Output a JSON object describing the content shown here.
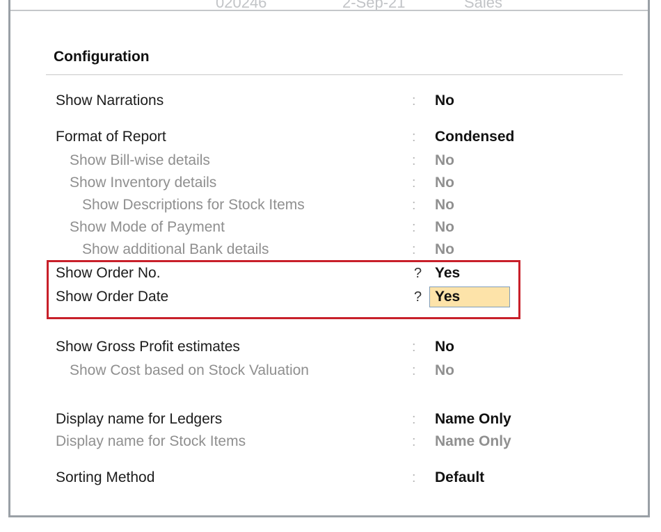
{
  "background_header": {
    "items": [
      "020246",
      "2-Sep-21",
      "Sales"
    ]
  },
  "title": "Configuration",
  "options": [
    {
      "label": "Show Narrations",
      "sep": ":",
      "value": "No",
      "dim": false
    },
    {
      "label": "Format of Report",
      "sep": ":",
      "value": "Condensed",
      "dim": false
    },
    {
      "label": "Show Bill-wise details",
      "sep": ":",
      "value": "No",
      "dim": true
    },
    {
      "label": "Show Inventory details",
      "sep": ":",
      "value": "No",
      "dim": true
    },
    {
      "label": "Show Descriptions for Stock Items",
      "sep": ":",
      "value": "No",
      "dim": true
    },
    {
      "label": "Show Mode of Payment",
      "sep": ":",
      "value": "No",
      "dim": true
    },
    {
      "label": "Show additional Bank details",
      "sep": ":",
      "value": "No",
      "dim": true
    },
    {
      "label": "Show Order No.",
      "sep": "?",
      "value": "Yes",
      "dim": false
    },
    {
      "label": "Show Order Date",
      "sep": "?",
      "value": "Yes",
      "dim": false,
      "active": true
    },
    {
      "label": "Show Gross Profit estimates",
      "sep": ":",
      "value": "No",
      "dim": false
    },
    {
      "label": "Show Cost based on Stock Valuation",
      "sep": ":",
      "value": "No",
      "dim": true
    },
    {
      "label": "Display name for Ledgers",
      "sep": ":",
      "value": "Name Only",
      "dim": false
    },
    {
      "label": "Display name for Stock Items",
      "sep": ":",
      "value": "Name Only",
      "dim": true
    },
    {
      "label": "Sorting Method",
      "sep": ":",
      "value": "Default",
      "dim": false
    }
  ],
  "colors": {
    "highlight_border": "#c8202a",
    "active_field_bg": "#fde3a9"
  }
}
